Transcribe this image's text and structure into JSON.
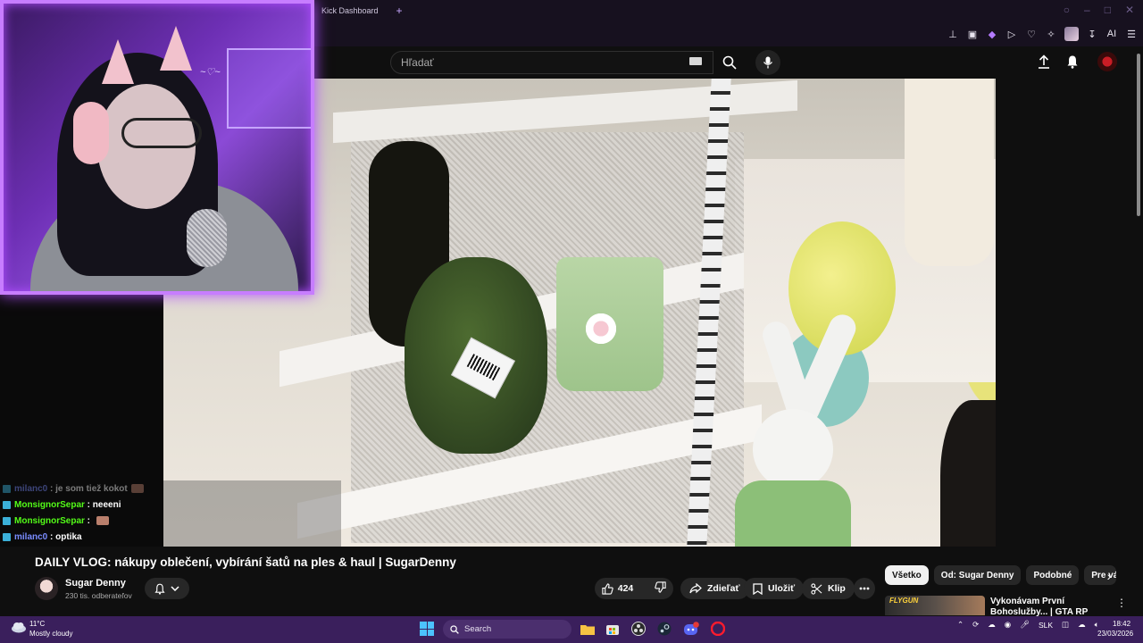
{
  "browser": {
    "tab_title": "Kick Dashboard",
    "new_tab_symbol": "+",
    "ext_ai_label": "AI"
  },
  "youtube": {
    "search_placeholder": "Hľadať",
    "video_title": "DAILY VLOG: nákupy oblečení, vybírání šatů na ples & haul | SugarDenny",
    "channel_name": "Sugar Denny",
    "channel_subs": "230 tis. odberateľov",
    "like_count": "424",
    "share_label": "Zdieľať",
    "save_label": "Uložiť",
    "clip_label": "Klip",
    "chips": [
      "Všetko",
      "Od: Sugar Denny",
      "Podobné",
      "Pre vá"
    ],
    "related": {
      "thumb_label": "FLYGUN",
      "title": "Vykonávam První Bohoslužby... | GTA RP"
    }
  },
  "stream_overlay": {
    "chat": [
      {
        "user": "milanc0",
        "message": "je som tiež kokot",
        "color": "blue",
        "faded": true,
        "emote": true
      },
      {
        "user": "MonsignorSepar",
        "message": "neeeni",
        "color": "green",
        "faded": false,
        "emote": false
      },
      {
        "user": "MonsignorSepar",
        "message": "",
        "color": "green",
        "faded": false,
        "emote": true
      },
      {
        "user": "milanc0",
        "message": "optika",
        "color": "blue",
        "faded": false,
        "emote": false
      }
    ]
  },
  "taskbar": {
    "temperature": "11°C",
    "weather": "Mostly cloudy",
    "search_label": "Search",
    "language": "SLK",
    "time": "18:42",
    "date": "23/03/2026",
    "discord_badge": "55"
  },
  "colors": {
    "webcam_border": "#c77dff",
    "kick_green": "#53fc18",
    "taskbar": "#3a1f5c"
  }
}
